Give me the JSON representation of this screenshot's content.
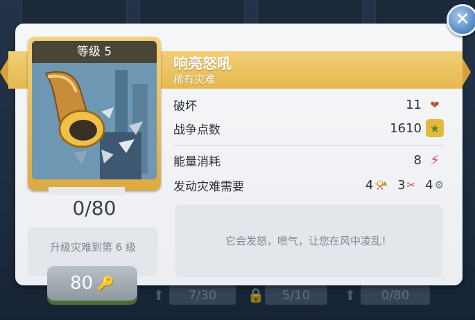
{
  "card": {
    "level_label": "等级 5",
    "progress": "0/80",
    "upgrade_text": "升级灾难到第 6 级",
    "cost": "80",
    "cost_icon": "key-icon"
  },
  "disaster": {
    "name": "响亮怒吼",
    "rarity": "稀有灾难",
    "description": "它会发怒，喷气，让您在风中凌乱！"
  },
  "stats": {
    "destruction_label": "破坏",
    "destruction_value": "11",
    "war_points_label": "战争点数",
    "war_points_value": "1610",
    "energy_label": "能量消耗",
    "energy_value": "8",
    "requirements_label": "发动灾难需要",
    "requirements": [
      {
        "count": "4",
        "icon": "horn-icon"
      },
      {
        "count": "3",
        "icon": "pliers-icon"
      },
      {
        "count": "4",
        "icon": "horn-piece-icon"
      }
    ]
  },
  "background_bars": [
    "7/30",
    "5/10",
    "0/80"
  ],
  "colors": {
    "banner": "#e6b84e",
    "card_frame": "#dcaa40",
    "heart": "#b8563a",
    "shield": "#e2b93b",
    "energy": "#d9477e",
    "close": "#4f86c4"
  }
}
